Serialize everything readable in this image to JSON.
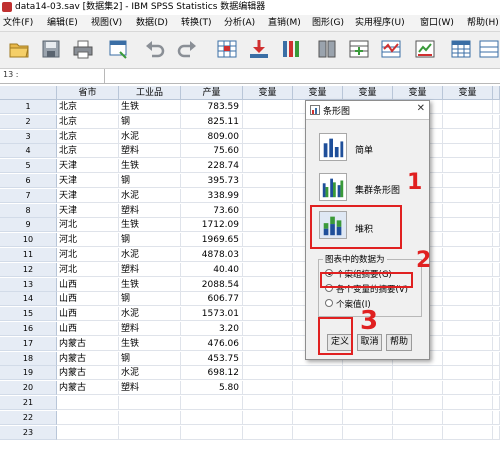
{
  "window": {
    "title": "data14-03.sav [数据集2] - IBM SPSS Statistics 数据编辑器"
  },
  "menu": [
    "文件(F)",
    "编辑(E)",
    "视图(V)",
    "数据(D)",
    "转换(T)",
    "分析(A)",
    "直销(M)",
    "图形(G)",
    "实用程序(U)",
    "窗口(W)",
    "帮助(H)"
  ],
  "cell_editor": {
    "reference": "13 :"
  },
  "grid": {
    "columns": [
      "省市",
      "工业品",
      "产量",
      "变量",
      "变量",
      "变量",
      "变量",
      "变量",
      "变量"
    ],
    "rows": [
      {
        "n": "1",
        "city": "北京",
        "product": "生铁",
        "output": "783.59"
      },
      {
        "n": "2",
        "city": "北京",
        "product": "钢",
        "output": "825.11"
      },
      {
        "n": "3",
        "city": "北京",
        "product": "水泥",
        "output": "809.00"
      },
      {
        "n": "4",
        "city": "北京",
        "product": "塑料",
        "output": "75.60"
      },
      {
        "n": "5",
        "city": "天津",
        "product": "生铁",
        "output": "228.74"
      },
      {
        "n": "6",
        "city": "天津",
        "product": "钢",
        "output": "395.73"
      },
      {
        "n": "7",
        "city": "天津",
        "product": "水泥",
        "output": "338.99"
      },
      {
        "n": "8",
        "city": "天津",
        "product": "塑料",
        "output": "73.60"
      },
      {
        "n": "9",
        "city": "河北",
        "product": "生铁",
        "output": "1712.09"
      },
      {
        "n": "10",
        "city": "河北",
        "product": "钢",
        "output": "1969.65"
      },
      {
        "n": "11",
        "city": "河北",
        "product": "水泥",
        "output": "4878.03"
      },
      {
        "n": "12",
        "city": "河北",
        "product": "塑料",
        "output": "40.40"
      },
      {
        "n": "13",
        "city": "山西",
        "product": "生铁",
        "output": "2088.54"
      },
      {
        "n": "14",
        "city": "山西",
        "product": "钢",
        "output": "606.77"
      },
      {
        "n": "15",
        "city": "山西",
        "product": "水泥",
        "output": "1573.01"
      },
      {
        "n": "16",
        "city": "山西",
        "product": "塑料",
        "output": "3.20"
      },
      {
        "n": "17",
        "city": "内蒙古",
        "product": "生铁",
        "output": "476.06"
      },
      {
        "n": "18",
        "city": "内蒙古",
        "product": "钢",
        "output": "453.75"
      },
      {
        "n": "19",
        "city": "内蒙古",
        "product": "水泥",
        "output": "698.12"
      },
      {
        "n": "20",
        "city": "内蒙古",
        "product": "塑料",
        "output": "5.80"
      },
      {
        "n": "21",
        "city": "",
        "product": "",
        "output": ""
      },
      {
        "n": "22",
        "city": "",
        "product": "",
        "output": ""
      },
      {
        "n": "23",
        "city": "",
        "product": "",
        "output": ""
      }
    ]
  },
  "dialog": {
    "title": "条形图",
    "chart_types": [
      {
        "label": "简单",
        "icon": "simple-bar-chart-icon"
      },
      {
        "label": "集群条形图",
        "icon": "clustered-bar-chart-icon"
      },
      {
        "label": "堆积",
        "icon": "stacked-bar-chart-icon",
        "selected": true
      }
    ],
    "data_group": {
      "legend": "图表中的数据为",
      "options": [
        {
          "label": "个案组摘要(G)",
          "selected": true
        },
        {
          "label": "各个变量的摘要(V)",
          "selected": false
        },
        {
          "label": "个案值(I)",
          "selected": false
        }
      ]
    },
    "buttons": {
      "define": "定义",
      "cancel": "取消",
      "help": "帮助"
    }
  },
  "annotations": {
    "step1": "1",
    "step2": "2",
    "step3": "3"
  },
  "colors": {
    "header_bg": "#e6ecf5",
    "annotation_red": "#e02020",
    "bar_blue": "#1f4f9a",
    "bar_green": "#3a9a3a"
  }
}
